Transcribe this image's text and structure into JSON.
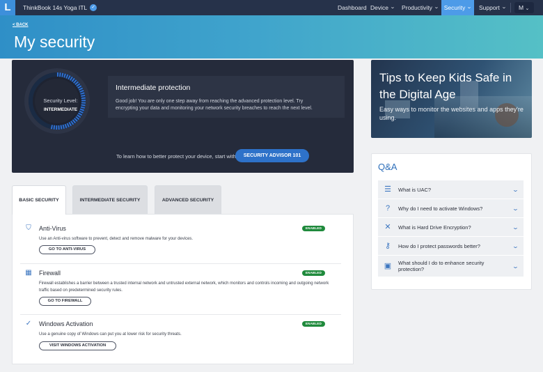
{
  "topbar": {
    "logo": "L",
    "device_name": "ThinkBook 14s Yoga ITL",
    "nav": [
      {
        "label": "Dashboard"
      },
      {
        "label": "Device"
      },
      {
        "label": "Productivity"
      },
      {
        "label": "Security"
      },
      {
        "label": "Support"
      }
    ],
    "avatar": "M",
    "active_color": "#4d9be8"
  },
  "header": {
    "back": "< BACK",
    "title": "My security"
  },
  "status_panel": {
    "level_label": "Security Level:",
    "level_value": "INTERMEDIATE",
    "level_progress": 0.55,
    "heading": "Intermediate protection",
    "description": "Good job! You are only one step away from reaching the advanced protection level. Try encrypting your data and monitoring your network security breaches to reach the next level.",
    "advisor_text": "To learn how to better protect your device, start with",
    "advisor_button": "SECURITY ADVISOR 101"
  },
  "tips": {
    "title": "Tips to Keep Kids Safe in the Digital Age",
    "subtitle": "Easy ways to monitor the websites and apps they're using."
  },
  "qa": {
    "title": "Q&A",
    "items": [
      {
        "icon": "database-icon",
        "text": "What is UAC?"
      },
      {
        "icon": "question-circle-icon",
        "text": "Why do I need to activate Windows?"
      },
      {
        "icon": "tools-icon",
        "text": "What is Hard Drive Encryption?"
      },
      {
        "icon": "key-icon",
        "text": "How do I protect passwords better?"
      },
      {
        "icon": "lock-icon",
        "text": "What should I do to enhance security protection?"
      }
    ]
  },
  "tabs": [
    {
      "label": "BASIC SECURITY",
      "active": true
    },
    {
      "label": "INTERMEDIATE SECURITY",
      "active": false
    },
    {
      "label": "ADVANCED SECURITY",
      "active": false
    }
  ],
  "features": [
    {
      "icon": "shield-icon",
      "title": "Anti-Virus",
      "status": "ENABLED",
      "description": "Use an Anti-virus software to prevent, detect and remove malware for your devices.",
      "button": "GO TO ANTI-VIRUS"
    },
    {
      "icon": "firewall-icon",
      "title": "Firewall",
      "status": "ENABLED",
      "description": "Firewall establishes a barrier between a trusted internal network and untrusted external network, which monitors and controls incoming and outgoing network traffic based on predetermined security rules.",
      "button": "GO TO FIREWALL"
    },
    {
      "icon": "check-circle-icon",
      "title": "Windows Activation",
      "status": "ENABLED",
      "description": "Use a genuine copy of Windows can put you at lower risk for security threats.",
      "button": "VISIT WINDOWS ACTIVATION"
    }
  ],
  "colors": {
    "accent": "#2e72c9",
    "enabled": "#1f8a3c",
    "panel": "#252b3b"
  }
}
